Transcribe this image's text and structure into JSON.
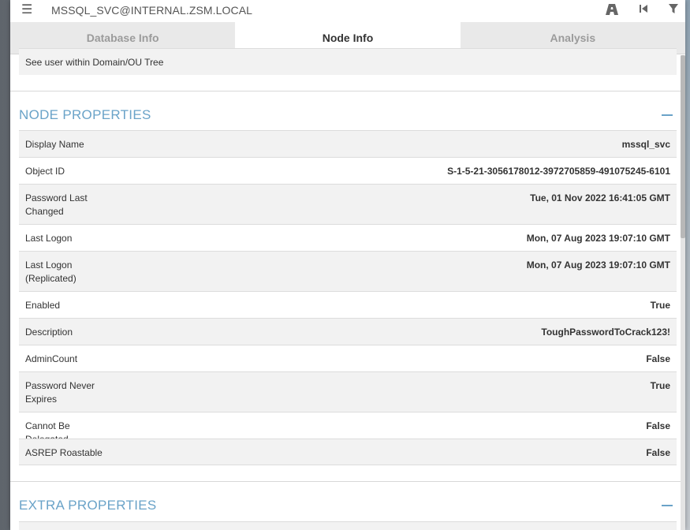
{
  "header": {
    "menu_icon": "hamburger-icon",
    "title": "MSSQL_SVC@INTERNAL.ZSM.LOCAL",
    "right_icons": [
      "path-icon",
      "back-to-start-icon",
      "filter-icon"
    ]
  },
  "tabs": [
    {
      "label": "Database Info",
      "active": false
    },
    {
      "label": "Node Info",
      "active": true
    },
    {
      "label": "Analysis",
      "active": false
    }
  ],
  "see_user": {
    "label": "See user within Domain/OU Tree"
  },
  "node_properties": {
    "title": "NODE PROPERTIES",
    "rows": [
      {
        "label": "Display Name",
        "value": "mssql_svc"
      },
      {
        "label": "Object ID",
        "value": "S-1-5-21-3056178012-3972705859-491075245-6101"
      },
      {
        "label": "Password Last Changed",
        "value": "Tue, 01 Nov 2022 16:41:05 GMT"
      },
      {
        "label": "Last Logon",
        "value": "Mon, 07 Aug 2023 19:07:10 GMT"
      },
      {
        "label": "Last Logon (Replicated)",
        "value": "Mon, 07 Aug 2023 19:07:10 GMT"
      },
      {
        "label": "Enabled",
        "value": "True"
      },
      {
        "label": "Description",
        "value": "ToughPasswordToCrack123!"
      },
      {
        "label": "AdminCount",
        "value": "False"
      },
      {
        "label": "Password Never Expires",
        "value": "True"
      },
      {
        "label": "Cannot Be Delegated",
        "value": "False"
      },
      {
        "label": "ASREP Roastable",
        "value": "False"
      }
    ]
  },
  "extra_properties": {
    "title": "EXTRA PROPERTIES"
  },
  "colors": {
    "accent": "#6aa3c8",
    "row_odd": "#f2f2f2",
    "tab_inactive": "#e9e9e9"
  }
}
